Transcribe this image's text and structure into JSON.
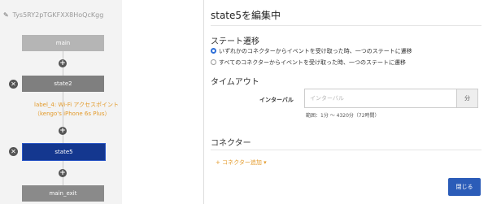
{
  "workflow": {
    "id": "Tys5RY2pTGKFXX8HoQcKgg",
    "nodes": {
      "main": "main",
      "state2": "state2",
      "state5": "state5",
      "exit": "main_exit"
    },
    "transition_label": "label_4: Wi-Fi アクセスポイント（kengo's iPhone 6s Plus）",
    "add_symbol": "+",
    "delete_symbol": "✕"
  },
  "editor": {
    "title": "state5を編集中",
    "transition": {
      "heading": "ステート遷移",
      "option_any": "いずれかのコネクターからイベントを受け取った時、一つのステートに遷移",
      "option_all": "すべてのコネクターからイベントを受け取った時、一つのステートに遷移",
      "selected": "option_any"
    },
    "timeout": {
      "heading": "タイムアウト",
      "interval_label": "インターバル",
      "interval_placeholder": "インターバル",
      "unit": "分",
      "help": "範囲：1分 〜 4320分（72時間）"
    },
    "connector": {
      "heading": "コネクター",
      "add_label": "コネクター追加"
    },
    "close_label": "閉じる"
  },
  "colors": {
    "accent": "#2b5cb8",
    "link": "#e39a2a",
    "selected_node": "#14378f"
  },
  "icons": {
    "title": "pencil-icon",
    "add": "plus-circle-icon",
    "delete": "close-circle-icon",
    "caret": "caret-down-icon"
  }
}
